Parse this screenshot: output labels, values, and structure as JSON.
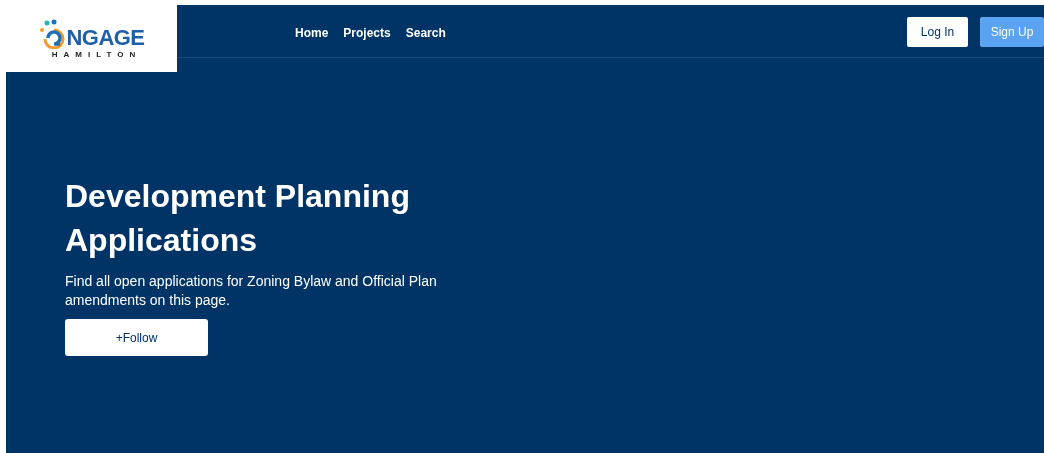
{
  "logo": {
    "word": "NGAGE",
    "subtitle": "HAMILTON"
  },
  "nav": [
    "Home",
    "Projects",
    "Search"
  ],
  "auth": {
    "login": "Log In",
    "signup": "Sign Up"
  },
  "hero": {
    "title": "Development Planning Applications",
    "description": "Find all open applications for Zoning Bylaw and Official Plan amendments on this page.",
    "follow": "+Follow"
  }
}
